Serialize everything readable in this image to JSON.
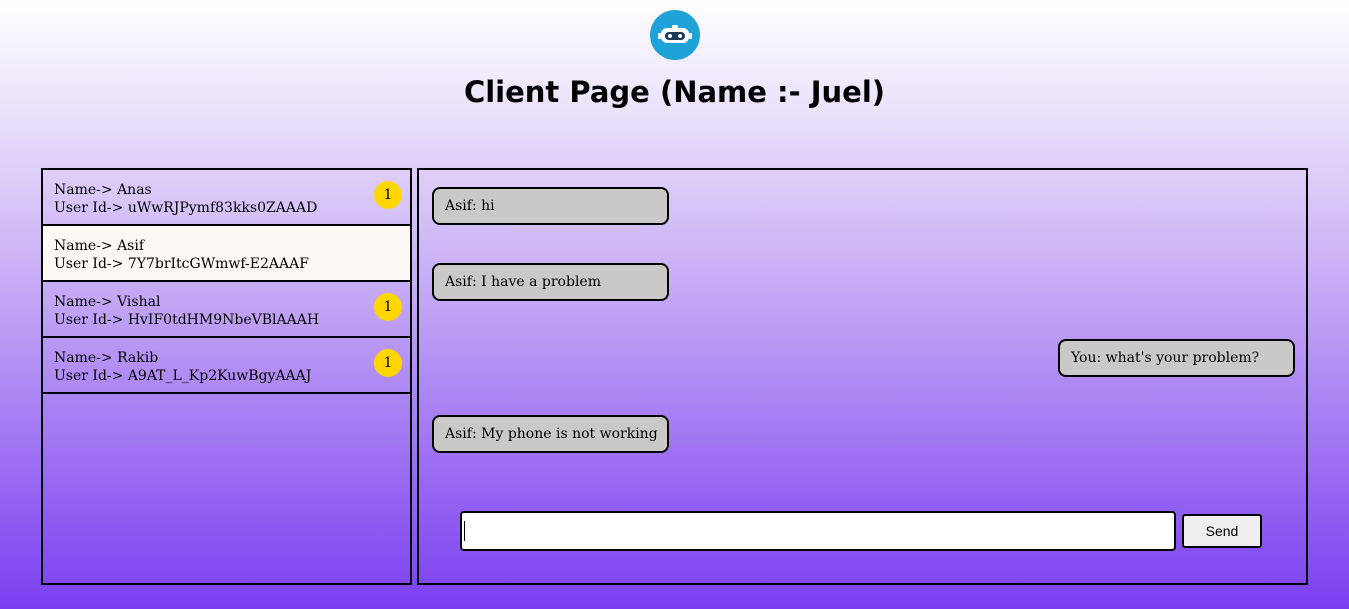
{
  "header": {
    "logo_icon": "robot-icon",
    "title": "Client Page (Name :- Juel)"
  },
  "users": [
    {
      "name_line": "Name-> Anas",
      "id_line": "User Id-> uWwRJPymf83kks0ZAAAD",
      "unread": "1",
      "active": false
    },
    {
      "name_line": "Name-> Asif",
      "id_line": "User Id-> 7Y7brItcGWmwf-E2AAAF",
      "unread": "",
      "active": true
    },
    {
      "name_line": "Name-> Vishal",
      "id_line": "User Id-> HvIF0tdHM9NbeVBlAAAH",
      "unread": "1",
      "active": false
    },
    {
      "name_line": "Name-> Rakib",
      "id_line": "User Id-> A9AT_L_Kp2KuwBgyAAAJ",
      "unread": "1",
      "active": false
    }
  ],
  "messages": [
    {
      "text": "Asif: hi",
      "side": "left"
    },
    {
      "text": "Asif: I have a problem",
      "side": "left"
    },
    {
      "text": "You: what's your problem?",
      "side": "right"
    },
    {
      "text": "Asif: My phone is not working",
      "side": "left"
    }
  ],
  "composer": {
    "value": "",
    "send_label": "Send"
  },
  "colors": {
    "badge": "#ffd600",
    "bubble": "#cbc8c8",
    "logo": "#1fa2d8",
    "active_row": "#fdf8f6"
  }
}
